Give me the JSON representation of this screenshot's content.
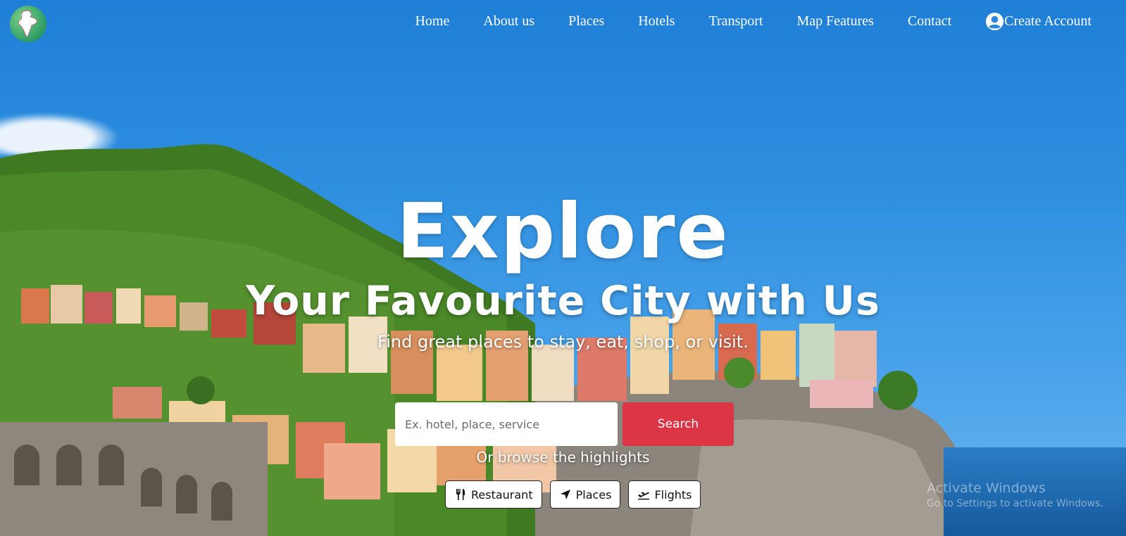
{
  "nav": {
    "logo_icon": "india-map-logo-icon",
    "links": [
      "Home",
      "About us",
      "Places",
      "Hotels",
      "Transport",
      "Map Features",
      "Contact"
    ],
    "account_label": "Create Account",
    "account_icon": "user-circle-icon"
  },
  "hero": {
    "title": "Explore",
    "subtitle": "Your Favourite City with Us",
    "tagline": "Find great places to stay, eat, shop, or visit."
  },
  "search": {
    "placeholder": "Ex. hotel, place, service",
    "value": "",
    "button_label": "Search",
    "button_color": "#dc3545"
  },
  "browse": {
    "label": "Or browse the highlights",
    "chips": [
      {
        "label": "Restaurant",
        "icon": "utensils-icon"
      },
      {
        "label": "Places",
        "icon": "location-arrow-icon"
      },
      {
        "label": "Flights",
        "icon": "plane-departure-icon"
      }
    ]
  },
  "watermark": {
    "title": "Activate Windows",
    "subtitle": "Go to Settings to activate Windows."
  }
}
